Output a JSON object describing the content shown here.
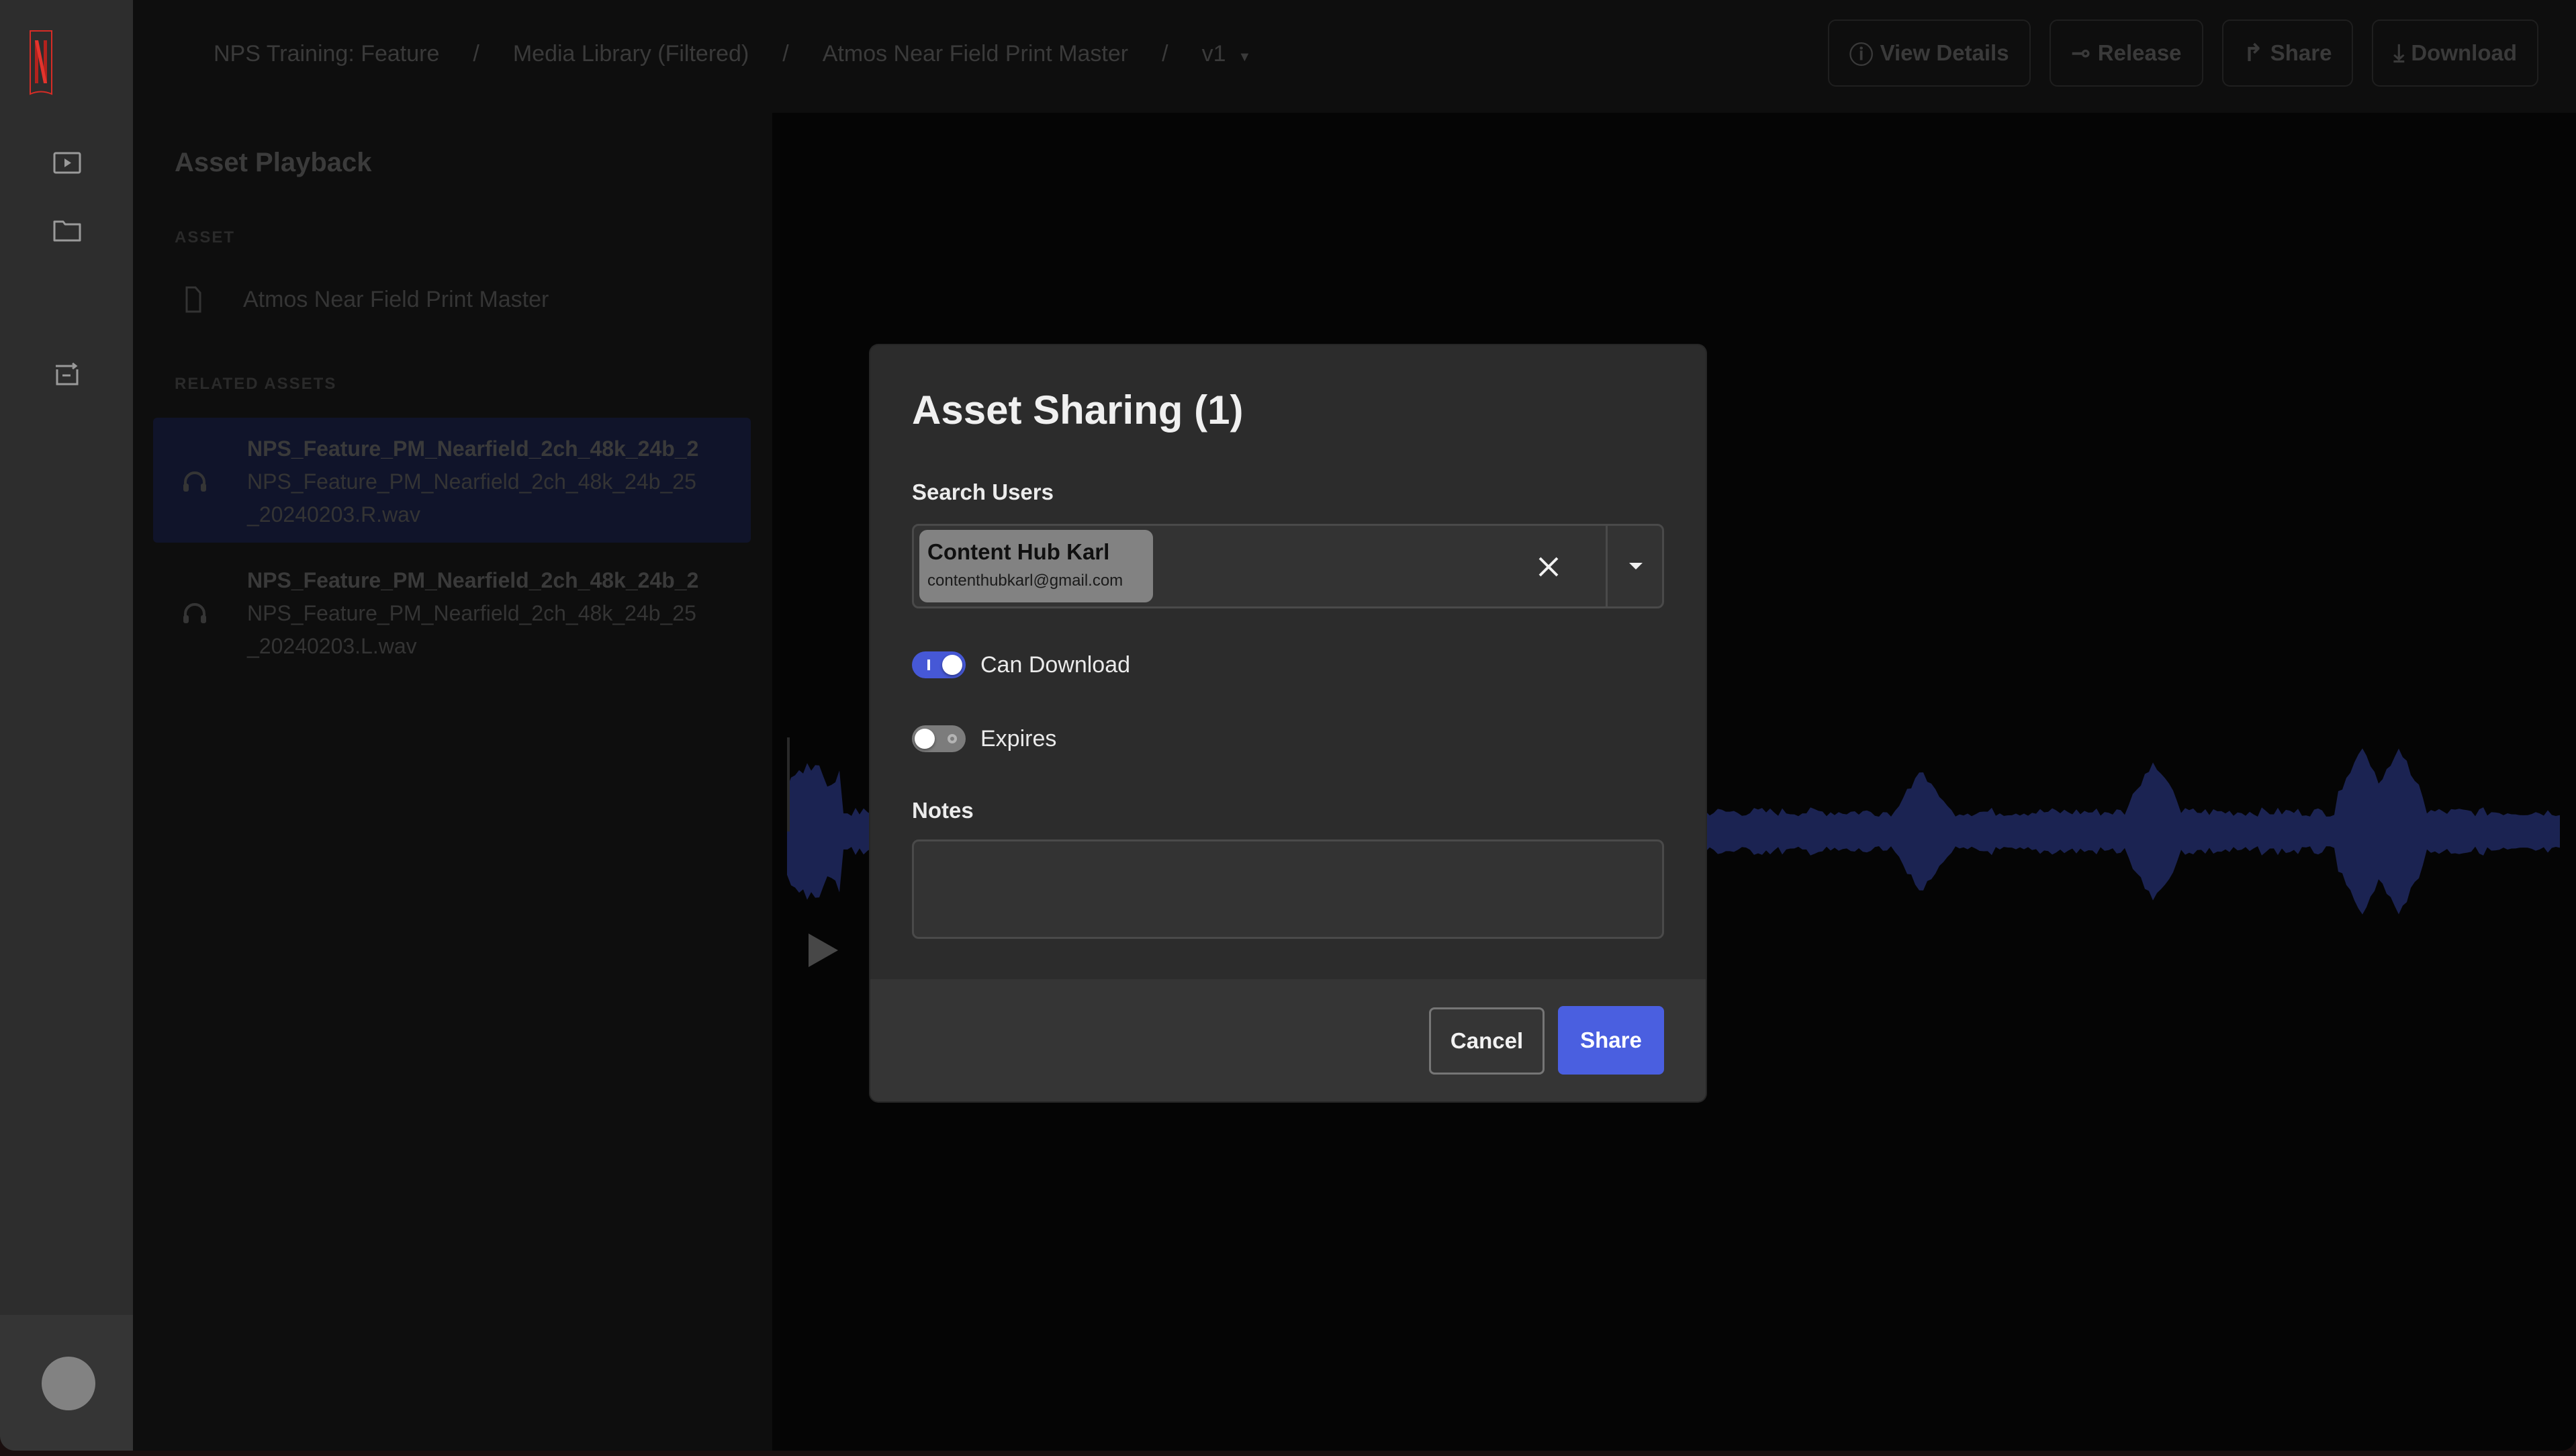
{
  "sidebar": {
    "logo": "netflix-logo",
    "icons": [
      "playback-icon",
      "folder-icon",
      "archive-transfer-icon"
    ],
    "avatar": "user-avatar"
  },
  "header": {
    "breadcrumb": [
      "NPS Training: Feature",
      "Media Library (Filtered)",
      "Atmos Near Field Print Master"
    ],
    "separator": "/",
    "version": "v1",
    "actions": [
      {
        "label": "View Details",
        "icon": "info-icon"
      },
      {
        "label": "Release",
        "icon": "release-icon"
      },
      {
        "label": "Share",
        "icon": "share-icon"
      },
      {
        "label": "Download",
        "icon": "download-icon"
      }
    ]
  },
  "left_panel": {
    "title": "Asset Playback",
    "asset_section": "ASSET",
    "asset_name": "Atmos Near Field Print Master",
    "related_section": "RELATED ASSETS",
    "related": [
      {
        "title": "NPS_Feature_PM_Nearfield_2ch_48k_24b_2",
        "line2": "NPS_Feature_PM_Nearfield_2ch_48k_24b_25",
        "line3": "_20240203.R.wav",
        "active": true
      },
      {
        "title": "NPS_Feature_PM_Nearfield_2ch_48k_24b_2",
        "line2": "NPS_Feature_PM_Nearfield_2ch_48k_24b_25",
        "line3": "_20240203.L.wav",
        "active": false
      }
    ]
  },
  "modal": {
    "title": "Asset Sharing (1)",
    "search_label": "Search Users",
    "selected_user": {
      "name": "Content Hub Karl",
      "email": "contenthubkarl@gmail.com"
    },
    "toggles": [
      {
        "label": "Can Download",
        "on": true
      },
      {
        "label": "Expires",
        "on": false
      }
    ],
    "notes_label": "Notes",
    "notes_value": "",
    "cancel_label": "Cancel",
    "share_label": "Share"
  },
  "colors": {
    "accent": "#4a5fe0",
    "toggle_on": "#4658d6",
    "brand_red": "#d62c26",
    "waveform": "#1b2352"
  }
}
